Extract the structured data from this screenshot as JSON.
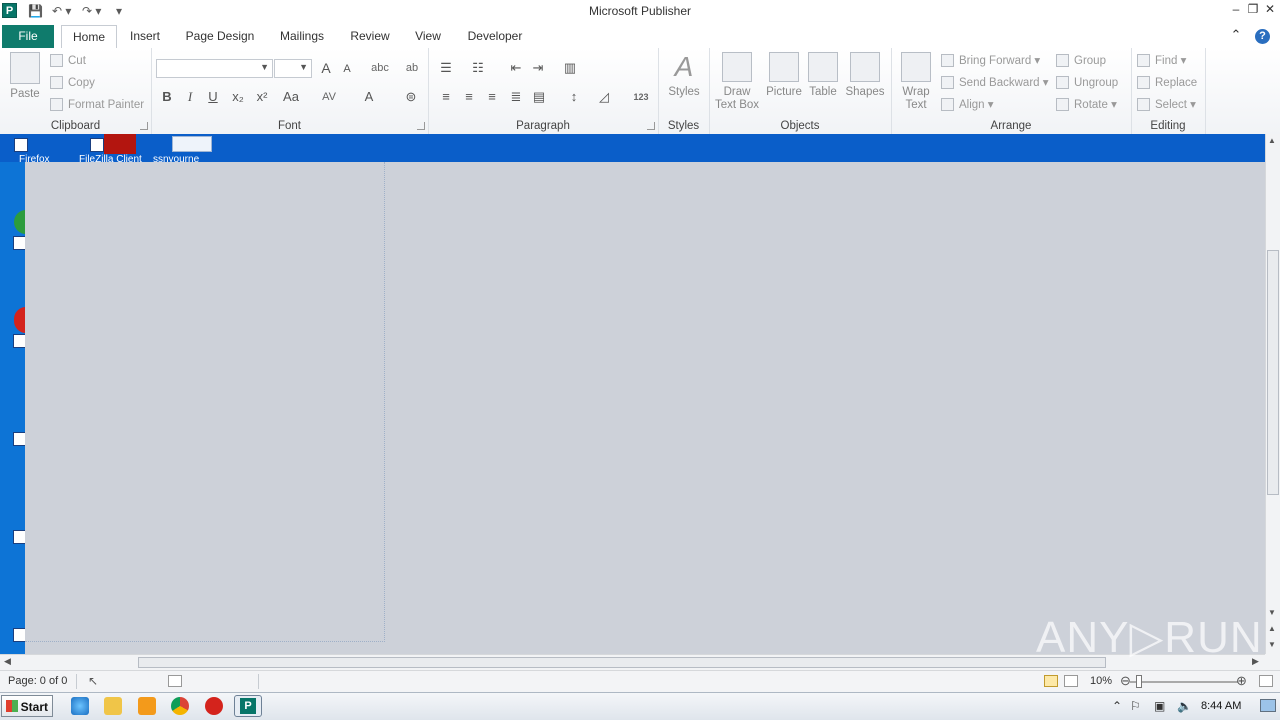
{
  "window": {
    "title": "Microsoft Publisher",
    "app_icon_letter": "P",
    "minimize": "–",
    "restore": "❐",
    "close": "✕"
  },
  "quick_access": {
    "save": "💾",
    "undo": "↶ ▾",
    "redo": "↷ ▾",
    "customize": "▾"
  },
  "tabs": [
    "File",
    "Home",
    "Insert",
    "Page Design",
    "Mailings",
    "Review",
    "View",
    "Developer"
  ],
  "active_tab": "Home",
  "ribbon_right": {
    "minimize_ribbon": "⌃",
    "help": "?"
  },
  "groups": {
    "clipboard": {
      "label": "Clipboard",
      "paste": "Paste",
      "cut": "Cut",
      "copy": "Copy",
      "format_painter": "Format Painter"
    },
    "font": {
      "label": "Font",
      "bold": "B",
      "italic": "I",
      "underline": "U",
      "subscript": "x₂",
      "superscript": "x²",
      "change_case": "Aa",
      "grow": "A",
      "shrink": "A",
      "clear": "abc",
      "char_spacing": "AV",
      "font_color": "A"
    },
    "paragraph": {
      "label": "Paragraph",
      "numbering": "123"
    },
    "styles": {
      "label": "Styles",
      "styles": "Styles"
    },
    "objects": {
      "label": "Objects",
      "draw_text_box_1": "Draw",
      "draw_text_box_2": "Text Box",
      "picture": "Picture",
      "table": "Table",
      "shapes": "Shapes"
    },
    "arrange": {
      "label": "Arrange",
      "wrap_text_1": "Wrap",
      "wrap_text_2": "Text",
      "bring_forward": "Bring Forward",
      "send_backward": "Send Backward",
      "align": "Align",
      "group": "Group",
      "ungroup": "Ungroup",
      "rotate": "Rotate"
    },
    "editing": {
      "label": "Editing",
      "find": "Find",
      "replace": "Replace",
      "select": "Select"
    }
  },
  "desktop_icons": {
    "firefox": "Firefox",
    "filezilla": "FileZilla Client",
    "item3": "ssnyourne"
  },
  "status": {
    "page": "Page: 0 of 0",
    "zoom": "10%"
  },
  "taskbar": {
    "start": "Start",
    "clock": "8:44 AM"
  },
  "watermark": "ANY▷RUN"
}
